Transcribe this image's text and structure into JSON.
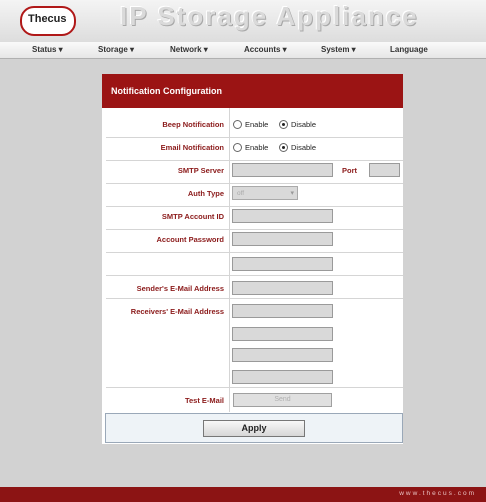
{
  "header": {
    "logo_text": "Thecus",
    "brand_title": "IP Storage Appliance"
  },
  "menu": [
    {
      "label": "Status ▾"
    },
    {
      "label": "Storage ▾"
    },
    {
      "label": "Network ▾"
    },
    {
      "label": "Accounts ▾"
    },
    {
      "label": "System ▾"
    },
    {
      "label": "Language"
    }
  ],
  "panel": {
    "title": "Notification Configuration",
    "beep": {
      "label": "Beep Notification",
      "enable": "Enable",
      "disable": "Disable",
      "selected": "Disable"
    },
    "email": {
      "label": "Email Notification",
      "enable": "Enable",
      "disable": "Disable",
      "selected": "Disable"
    },
    "smtp_server": {
      "label": "SMTP Server",
      "value": ""
    },
    "port": {
      "label": "Port",
      "value": ""
    },
    "auth_type": {
      "label": "Auth Type",
      "value": "off"
    },
    "account_id": {
      "label": "SMTP Account ID",
      "value": ""
    },
    "password": {
      "label": "Account Password",
      "value": ""
    },
    "sender": {
      "label": "Sender's E-Mail Address",
      "value": ""
    },
    "receivers": {
      "label": "Receivers' E-Mail Address",
      "values": [
        "",
        "",
        "",
        ""
      ]
    },
    "test": {
      "label": "Test E-Mail",
      "button": "Send"
    },
    "apply": "Apply"
  },
  "footer": {
    "url_text": "www.thecus.com"
  },
  "colors": {
    "accent": "#9b1414",
    "label": "#8b1a1a",
    "background": "#d2d2d2"
  }
}
